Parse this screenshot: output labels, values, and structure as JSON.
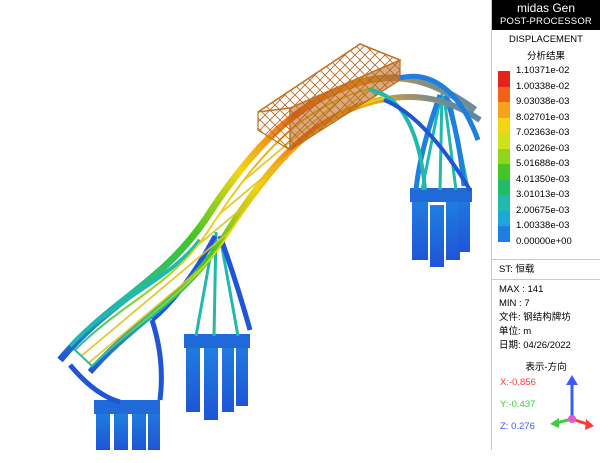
{
  "app": {
    "name": "midas Gen",
    "mode": "POST-PROCESSOR"
  },
  "result": {
    "title": "DISPLACEMENT",
    "subtitle": "分析结果"
  },
  "legend": {
    "labels": [
      "1.10371e-02",
      "1.00338e-02",
      "9.03038e-03",
      "8.02701e-03",
      "7.02363e-03",
      "6.02026e-03",
      "5.01688e-03",
      "4.01350e-03",
      "3.01013e-03",
      "2.00675e-03",
      "1.00338e-03",
      "0.00000e+00"
    ],
    "colors": [
      "#e5231b",
      "#f2601a",
      "#f7a21a",
      "#f2d515",
      "#cfe31a",
      "#8fd61a",
      "#45c525",
      "#22bb68",
      "#1fb9ae",
      "#1ea6d6",
      "#1f7fe0",
      "#1f55d6"
    ]
  },
  "info": {
    "st": "ST: 恒载",
    "max": "MAX : 141",
    "min": "MIN : 7",
    "file": "文件: 钢结构牌坊",
    "unit": "单位: m",
    "date": "日期: 04/26/2022"
  },
  "view": {
    "title": "表示-方向",
    "x": "X:-0.856",
    "y": "Y:-0.437",
    "z": "Z: 0.276",
    "x_color": "#ff3b3b",
    "y_color": "#3ccf3c",
    "z_color": "#3a5bff"
  }
}
